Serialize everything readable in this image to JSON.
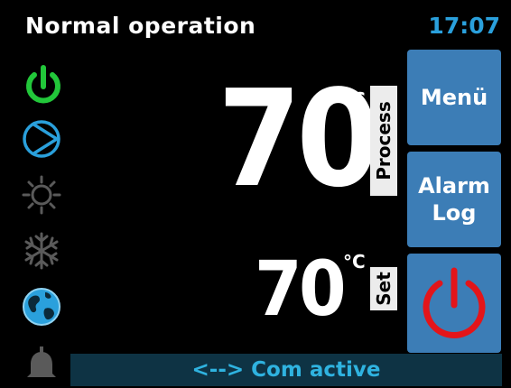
{
  "header": {
    "title": "Normal operation",
    "time": "17:07"
  },
  "status_icons": [
    {
      "name": "power-icon",
      "color": "#22c73a"
    },
    {
      "name": "pump-icon",
      "color": "#2aa0dc"
    },
    {
      "name": "sun-icon",
      "color": "#5a5a5a"
    },
    {
      "name": "snowflake-icon",
      "color": "#5a5a5a"
    },
    {
      "name": "globe-icon",
      "color": "#2aa0dc"
    },
    {
      "name": "bell-icon",
      "color": "#5a5a5a"
    }
  ],
  "process": {
    "value": "70",
    "unit": "°C",
    "label": "Process"
  },
  "set": {
    "value": "70",
    "unit": "°C",
    "label": "Set"
  },
  "buttons": {
    "menu": "Menü",
    "alarm_line1": "Alarm",
    "alarm_line2": "Log"
  },
  "power_button": {
    "icon": "power-icon",
    "color": "#e3151a"
  },
  "status_bar": {
    "text": "<--> Com active"
  }
}
